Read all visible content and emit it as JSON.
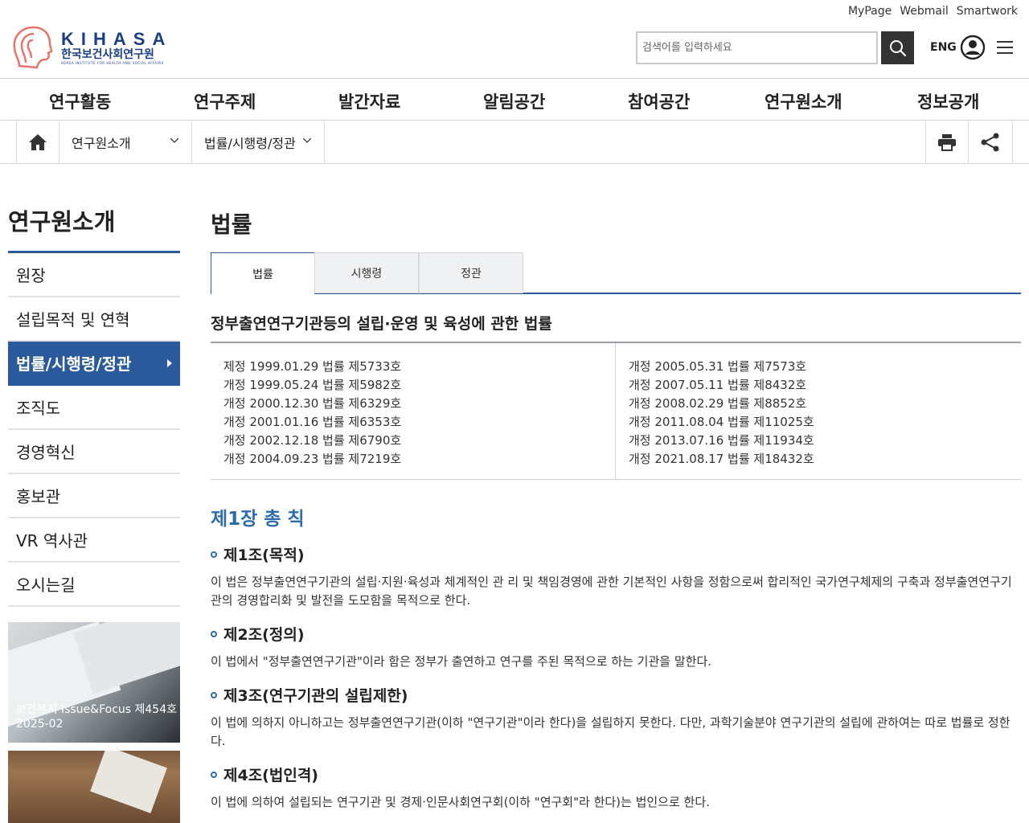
{
  "util_links": [
    "MyPage",
    "Webmail",
    "Smartwork"
  ],
  "logo": {
    "en": "KIHASA",
    "ko": "한국보건사회연구원",
    "sub": "KOREA INSTITUTE FOR HEALTH AND SOCIAL AFFAIRS"
  },
  "search": {
    "placeholder": "검색어를 입력하세요"
  },
  "lang": "ENG",
  "gnb": [
    "연구활동",
    "연구주제",
    "발간자료",
    "알림공간",
    "참여공간",
    "연구원소개",
    "정보공개"
  ],
  "location": {
    "depth1": "연구원소개",
    "depth2": "법률/시행령/정관"
  },
  "sidebar": {
    "title": "연구원소개",
    "items": [
      "원장",
      "설립목적 및 연혁",
      "법률/시행령/정관",
      "조직도",
      "경영혁신",
      "홍보관",
      "VR 역사관",
      "오시는길"
    ],
    "active_index": 2
  },
  "banner": {
    "line1": "보건복지 Issue&Focus 제454호",
    "line2": "2025-02"
  },
  "main": {
    "title": "법률",
    "tabs": [
      "법률",
      "시행령",
      "정관"
    ],
    "active_tab": 0,
    "law_title": "정부출연연구기관등의 설립·운영 및 육성에 관한 법률",
    "history_left": [
      "제정 1999.01.29 법률 제5733호",
      "개정 1999.05.24 법률 제5982호",
      "개정 2000.12.30 법률 제6329호",
      "개정 2001.01.16 법률 제6353호",
      "개정 2002.12.18 법률 제6790호",
      "개정 2004.09.23 법률 제7219호"
    ],
    "history_right": [
      "개정 2005.05.31 법률 제7573호",
      "개정 2007.05.11 법률 제8432호",
      "개정 2008.02.29 법률 제8852호",
      "개정 2011.08.04 법률 제11025호",
      "개정 2013.07.16 법률 제11934호",
      "개정 2021.08.17 법률 제18432호"
    ],
    "chapter": "제1장 총 칙",
    "articles": [
      {
        "head": "제1조(목적)",
        "body": "이 법은 정부출연연구기관의 설립·지원·육성과 체계적인 관 리 및 책임경영에 관한 기본적인 사항을 정함으로써 합리적인 국가연구체제의 구축과 정부출연연구기관의 경영합리화 및 발전을 도모함을 목적으로 한다."
      },
      {
        "head": "제2조(정의)",
        "body": "이 법에서 \"정부출연연구기관\"이라 함은 정부가 출연하고 연구를 주된 목적으로 하는 기관을 말한다."
      },
      {
        "head": "제3조(연구기관의 설립제한)",
        "body": "이 법에 의하지 아니하고는 정부출연연구기관(이하 \"연구기관\"이라 한다)을 설립하지 못한다. 다만, 과학기술분야 연구기관의 설립에 관하여는 따로 법률로 정한다."
      },
      {
        "head": "제4조(법인격)",
        "body": "이 법에 의하여 설립되는 연구기관 및 경제·인문사회연구회(이하 \"연구회\"라 한다)는 법인으로 한다."
      }
    ]
  },
  "colors": {
    "primary": "#2b5a9c",
    "chapter": "#2b6cb0",
    "logo": "#1b3f87",
    "logo_mark": "#e8756a"
  }
}
